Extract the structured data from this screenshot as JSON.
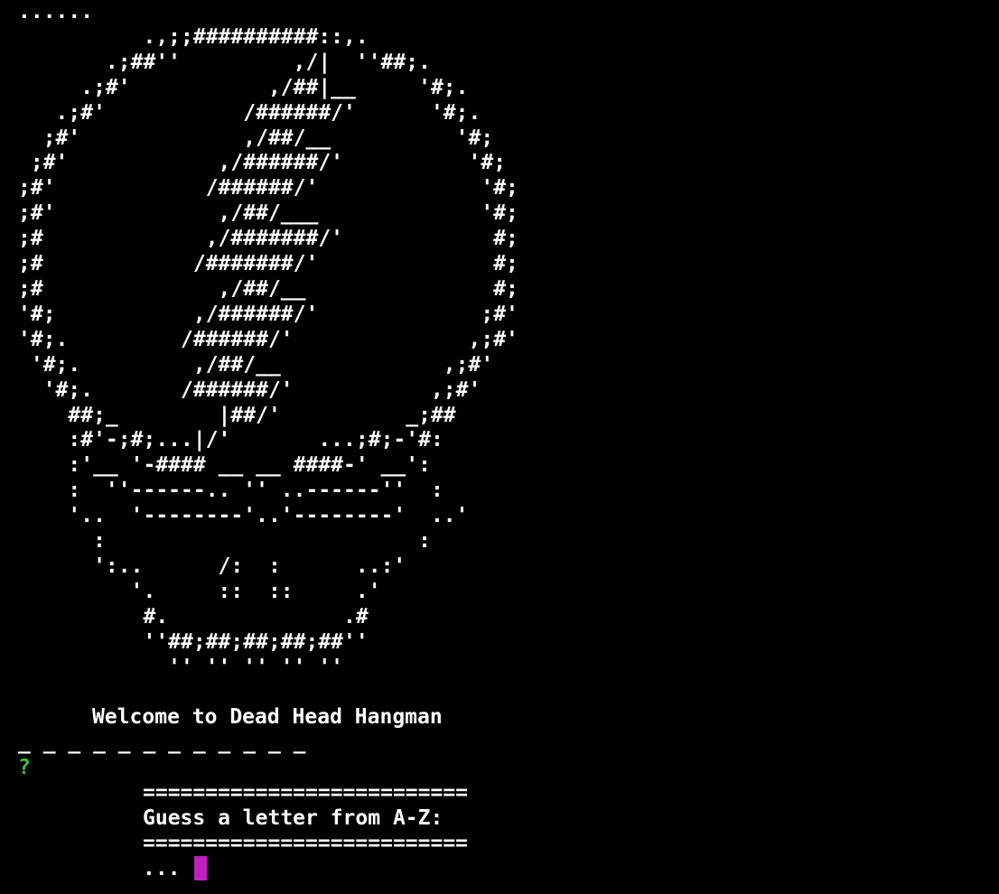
{
  "colors": {
    "background": "#000000",
    "text": "#ffffff",
    "prompt": "#3cc23c",
    "cursor": "#c020c0"
  },
  "terminal": {
    "ascii_art": "......\n          .,;;##########::,.\n       .;##''         ,/|  ''##;.\n     .;#'           ,/##|__     '#;.\n   .;#'           /######/'      '#;.\n  ;#'             ,/##/__          '#;\n ;#'            ,/######/'          '#;\n;#'            /######/'             '#;\n;#'             ,/##/___             '#;\n;#             ,/#######/'            #;\n;#            /#######/'              #;\n;#              ,/##/__               #;\n'#;           ,/######/'             ;#'\n'#;.         /######/'              ,;#'\n '#;.         ,/##/__             ,;#'\n  '#;.       /######/'           ,;#'\n    ##;_        |##/'          _;##\n    :#'-;#;...|/'       ...;#;-'#:\n    :'__ '-#### __ __ ####-' __':\n    :  ''------.. '' ..------''  :\n    '..  '--------'..'--------'  ..'\n      :                         :\n      ':..      /:  :      ..:'\n         '.     ::  ::     .'\n          #.              .#\n          ''##;##;##;##;##''\n            '' '' '' '' ''",
    "welcome": "Welcome to Dead Head Hangman",
    "word_blanks": "_ _ _ _ _ _ _ _ _ _ _ _",
    "prompt_symbol": "?",
    "separator": "==========================",
    "instruction": "Guess a letter from A-Z:",
    "input_prefix": "..."
  }
}
